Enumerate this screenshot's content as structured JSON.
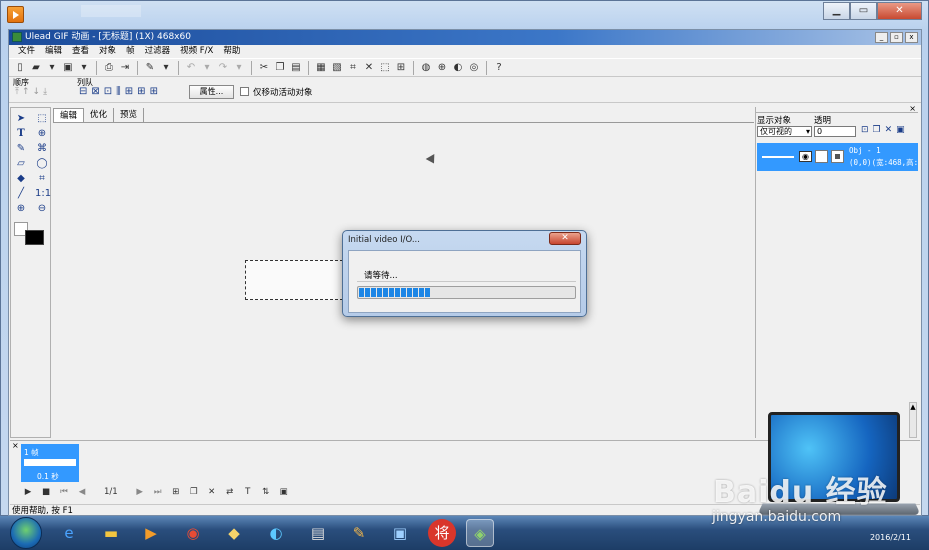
{
  "window": {
    "title": "Ulead GIF 动画 - [无标题] (1X) 468x60",
    "controls": {
      "min": "▁",
      "max": "▭",
      "close": "✕"
    },
    "mdi_controls": {
      "min": "_",
      "restore": "▫",
      "close": "x"
    }
  },
  "menu": [
    "文件",
    "编辑",
    "查看",
    "对象",
    "帧",
    "过滤器",
    "视频 F/X",
    "帮助"
  ],
  "toolbar2": {
    "order_label": "顺序",
    "arrange_label": "列队",
    "properties_button": "属性...",
    "move_active_only": "仅移动活动对象"
  },
  "tabs": [
    "编辑",
    "优化",
    "预览"
  ],
  "right_panel": {
    "pin": "×",
    "display_label": "显示对象",
    "opacity_label": "透明",
    "display_value": "仅可视的",
    "opacity_value": "0",
    "object": {
      "name": "Obj - 1",
      "info": "(0,0)(宽:468,高:6"
    }
  },
  "frames": {
    "close": "×",
    "frame_number": "1 帧",
    "frame_delay": "0.1 秒",
    "page": "1/1"
  },
  "status": "使用帮助, 按 F1",
  "dialog": {
    "title": "Initial video I/O...",
    "close": "✕",
    "message": "请等待...",
    "progress": 0.33
  },
  "taskbar": {
    "date": "2016/2/11"
  },
  "watermark": {
    "logo": "Baidu 经验",
    "url": "jingyan.baidu.com"
  },
  "colors": {
    "selection": "#3399ff",
    "progress": "#1c86e6",
    "title_gradient": "#1b4b9a"
  }
}
